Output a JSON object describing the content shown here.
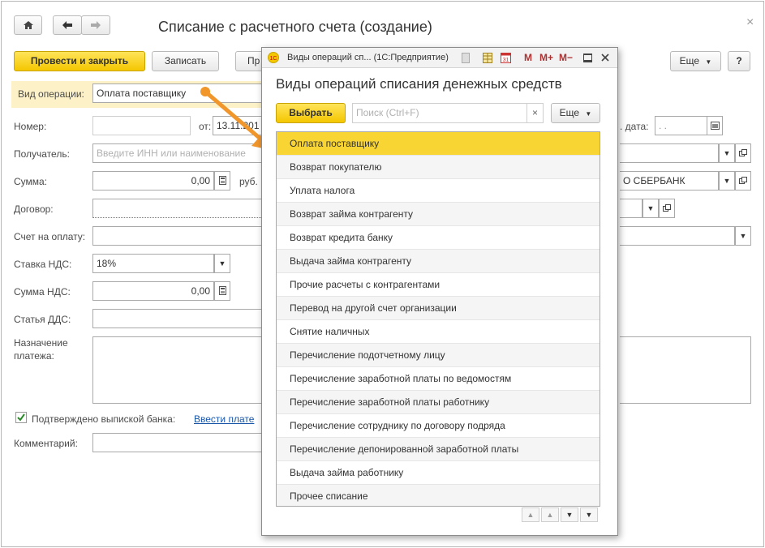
{
  "window": {
    "title": "Списание с расчетного счета (создание)",
    "close_glyph": "×"
  },
  "toolbar": {
    "post_close_label": "Провести и закрыть",
    "save_label": "Записать",
    "partial_button_label": "Пр",
    "more_label": "Еще",
    "help_label": "?"
  },
  "form": {
    "operation_label": "Вид операции:",
    "operation_value": "Оплата поставщику",
    "number_label": "Номер:",
    "from_label": "от:",
    "date_value": "13.11.201",
    "in_date_label": ". дата:",
    "in_date_value": ". .",
    "recipient_label": "Получатель:",
    "recipient_placeholder": "Введите ИНН или наименование",
    "amount_label": "Сумма:",
    "amount_value": "0,00",
    "currency": "руб.",
    "bank_value": "О СБЕРБАНК",
    "contract_label": "Договор:",
    "invoice_label": "Счет на оплату:",
    "vat_rate_label": "Ставка НДС:",
    "vat_rate_value": "18%",
    "vat_amount_label": "Сумма НДС:",
    "vat_amount_value": "0,00",
    "dds_label": "Статья ДДС:",
    "purpose_label_1": "Назначение",
    "purpose_label_2": "платежа:",
    "confirmed_label": "Подтверждено выпиской банка:",
    "confirmed_checked": true,
    "enter_payment_link": "Ввести плате",
    "comment_label": "Комментарий:"
  },
  "dialog": {
    "window_title": "Виды операций сп... (1С:Предприятие)",
    "heading": "Виды операций списания денежных средств",
    "select_label": "Выбрать",
    "search_placeholder": "Поиск (Ctrl+F)",
    "search_clear": "×",
    "more_label": "Еще",
    "tb_m": "M",
    "tb_mplus": "M+",
    "tb_mminus": "M−",
    "items": [
      "Оплата поставщику",
      "Возврат покупателю",
      "Уплата налога",
      "Возврат займа контрагенту",
      "Возврат кредита банку",
      "Выдача займа контрагенту",
      "Прочие расчеты с контрагентами",
      "Перевод на другой счет организации",
      "Снятие наличных",
      "Перечисление подотчетному лицу",
      "Перечисление заработной платы по ведомостям",
      "Перечисление заработной платы работнику",
      "Перечисление сотруднику по договору подряда",
      "Перечисление депонированной заработной платы",
      "Выдача займа работнику",
      "Прочее списание"
    ],
    "selected_index": 0
  },
  "colors": {
    "accent_yellow": "#f9d533",
    "highlight_field": "#fdf1c7",
    "arrow": "#f0962b",
    "link": "#1a56a8"
  },
  "icons": [
    "home-icon",
    "back-arrow-icon",
    "forward-arrow-icon",
    "calculator-icon",
    "calendar-icon",
    "open-form-icon",
    "checkbox-icon",
    "dropdown-icon",
    "app-logo-icon",
    "doc-icon",
    "table-icon",
    "calendar31-icon",
    "minimize-icon",
    "maximize-icon",
    "close-icon"
  ]
}
